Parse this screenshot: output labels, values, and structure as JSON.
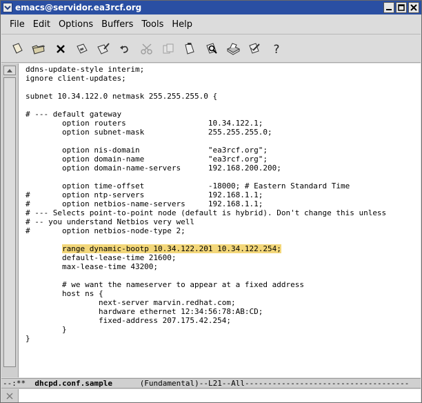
{
  "window": {
    "title": "emacs@servidor.ea3rcf.org"
  },
  "menu": {
    "items": [
      "File",
      "Edit",
      "Options",
      "Buffers",
      "Tools",
      "Help"
    ]
  },
  "toolbar": {
    "icons": [
      "new-file-icon",
      "open-folder-icon",
      "close-icon",
      "save-icon",
      "save-as-icon",
      "undo-icon",
      "cut-icon",
      "copy-icon",
      "paste-icon",
      "search-icon",
      "print-icon",
      "preferences-icon",
      "help-icon"
    ]
  },
  "editor": {
    "lines": [
      "ddns-update-style interim;",
      "ignore client-updates;",
      "",
      "subnet 10.34.122.0 netmask 255.255.255.0 {",
      "",
      "# --- default gateway",
      "        option routers                  10.34.122.1;",
      "        option subnet-mask              255.255.255.0;",
      "",
      "        option nis-domain               \"ea3rcf.org\";",
      "        option domain-name              \"ea3rcf.org\";",
      "        option domain-name-servers      192.168.200.200;",
      "",
      "        option time-offset              -18000; # Eastern Standard Time",
      "#       option ntp-servers              192.168.1.1;",
      "#       option netbios-name-servers     192.168.1.1;",
      "# --- Selects point-to-point node (default is hybrid). Don't change this unless",
      "# -- you understand Netbios very well",
      "#       option netbios-node-type 2;",
      "",
      "        range dynamic-bootp 10.34.122.201 10.34.122.254;",
      "        default-lease-time 21600;",
      "        max-lease-time 43200;",
      "",
      "        # we want the nameserver to appear at a fixed address",
      "        host ns {",
      "                next-server marvin.redhat.com;",
      "                hardware ethernet 12:34:56:78:AB:CD;",
      "                fixed-address 207.175.42.254;",
      "        }",
      "}"
    ],
    "highlighted_line_index": 20,
    "highlight_color": "#f3d77a"
  },
  "modeline": {
    "prefix": "--:**  ",
    "buffer_name": "dhcpd.conf.sample",
    "suffix": "      (Fundamental)--L21--All------------------------------------"
  },
  "colors": {
    "titlebar": "#2a4fa3",
    "background": "#dcdcdc"
  }
}
